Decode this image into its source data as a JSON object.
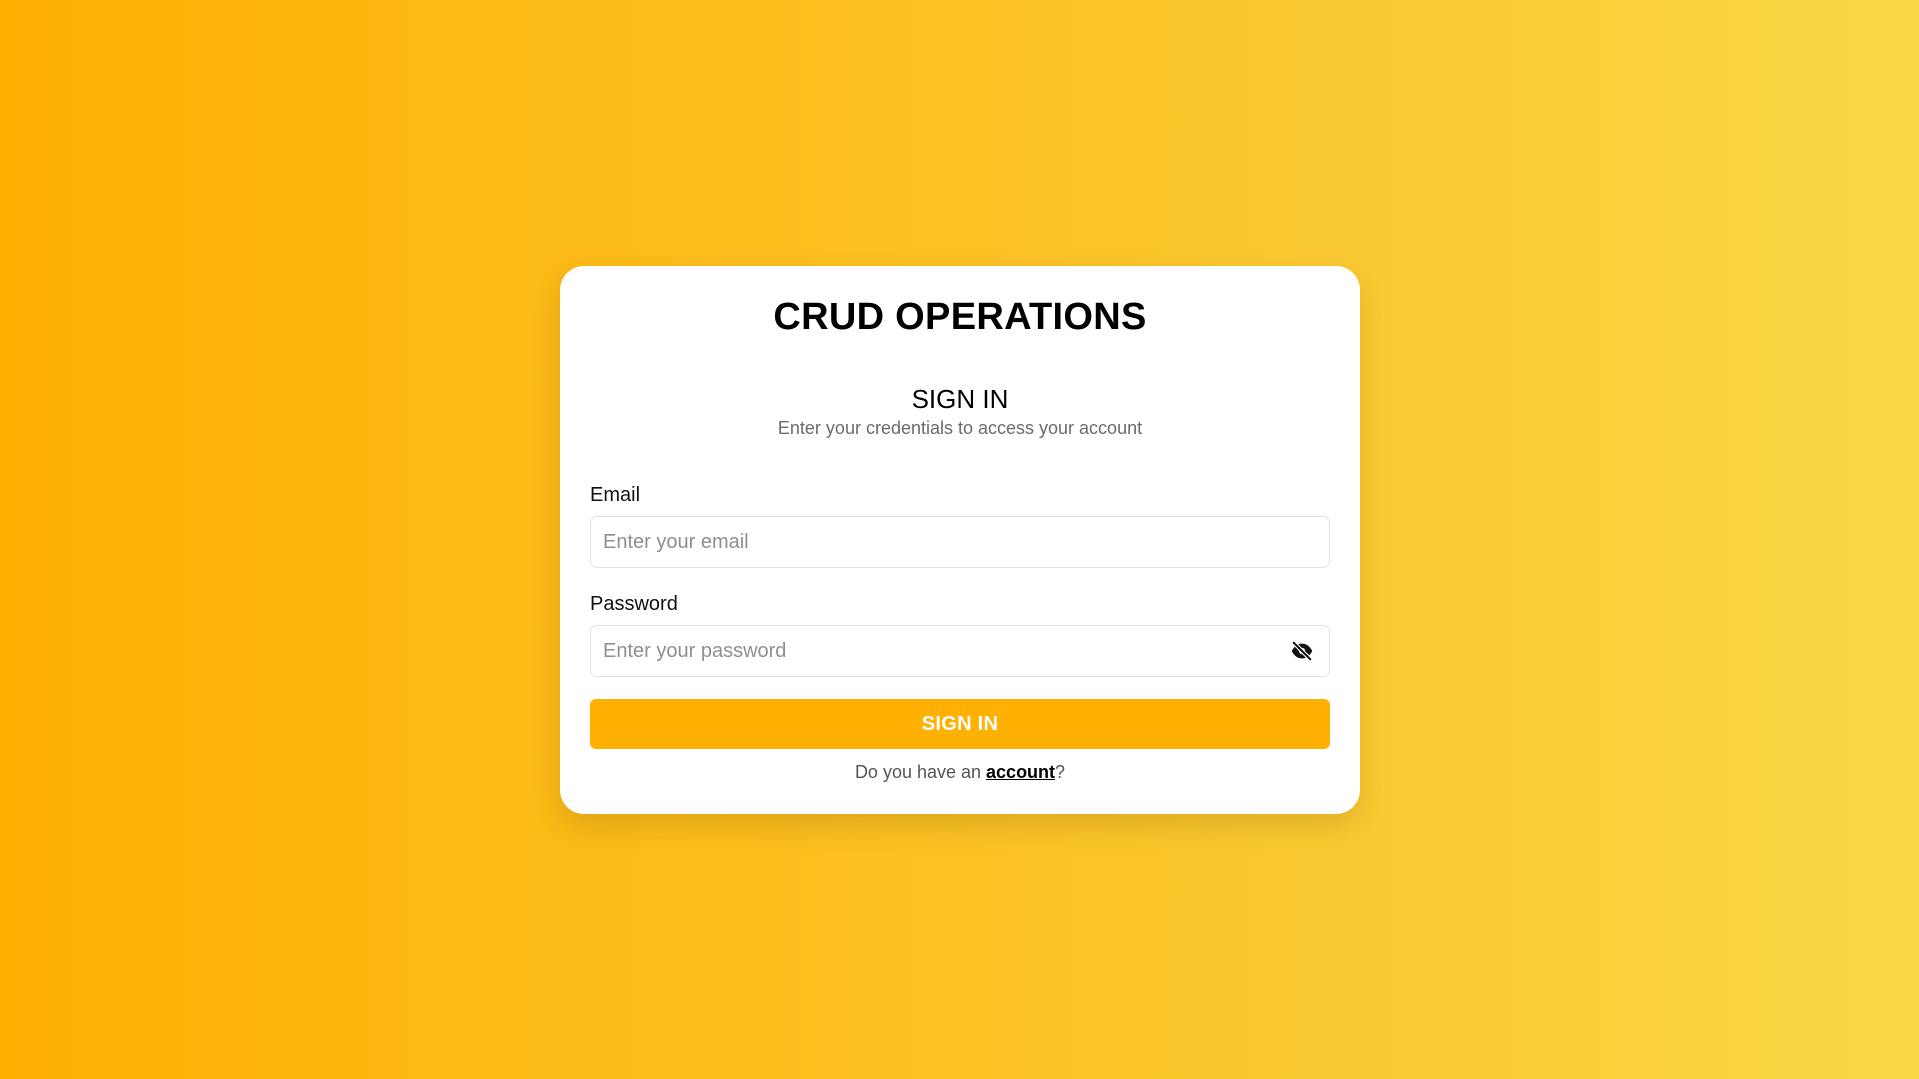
{
  "app": {
    "title": "CRUD OPERATIONS"
  },
  "form": {
    "title": "SIGN IN",
    "subtitle": "Enter your credentials to access your account",
    "email": {
      "label": "Email",
      "value": "",
      "placeholder": "Enter your email"
    },
    "password": {
      "label": "Password",
      "value": "",
      "placeholder": "Enter your password",
      "toggle_icon": "eye-slash-icon"
    },
    "submit_label": "SIGN IN",
    "footer": {
      "prefix": "Do you have an ",
      "link": "account",
      "suffix": "?"
    }
  },
  "colors": {
    "background_start": "#feb003",
    "background_end": "#f9d747",
    "button": "#feb003",
    "card": "#ffffff"
  }
}
